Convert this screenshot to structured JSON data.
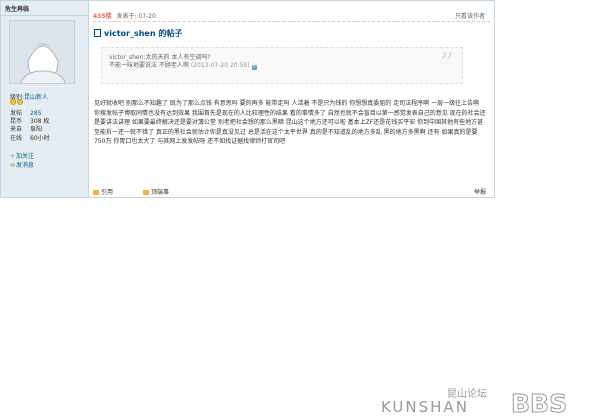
{
  "author": {
    "name": "危生再临"
  },
  "profile": {
    "level_label": "级别:",
    "level_value": "昆山新人",
    "stats": [
      {
        "key": "发帖",
        "value": "285"
      },
      {
        "key": "昆币",
        "value": "308 枚"
      },
      {
        "key": "注册时间",
        "value": ""
      }
    ],
    "extra": [
      {
        "key": "来自",
        "value": "阜阳"
      },
      {
        "key": "在线",
        "value": "60小时"
      }
    ],
    "add_follow": "加关注",
    "send_msg": "发消息"
  },
  "post": {
    "floor": "435楼",
    "posted": "发表于: 07-20",
    "only_author": "只看该作者",
    "title": "victor_shen 的帖子",
    "quote_line1": "victor_shen:太热天的  本人有空调吗?",
    "quote_line2a": "不能一味地要说法  不顾老人啊",
    "quote_time": "(2013-07-20 20:59)",
    "body": "见好就收吧 别那么不知趣了    既为了那么点钱  有意思吗  要的再多  能带走吗   人活着  不是只为钱的  你想想真委屈的  走司法程序啊      一层一级往上告啊     你搜发帖子博取同情也没有达到效果   我围首先是现在的人比较理性的结果    看的事情多了  自然也就不会盲目以第一感觉发表自己的意见    现在的社会还是要讲法讲理    如果要最终解决还是要对簿公堂   别老把社会想的那么黑暗   昆山这个地方还可以啦   基本上ZF还是花钱买平安    你到中国其他有些地方甚至能拆一还一就不错了  真正的黑社会就估计你是真没见过     总是活在这个太平世界    真的是不知道乱的地方多乱   黑的地方多黑啊   还有  如果真的是要750万  你胃口也太大了    与其网上发发帖呀  还不如找证据找律师打官司吧",
    "quote_action": "引用",
    "like_action": "顶端事",
    "report_action": "举报"
  },
  "watermark": {
    "cn": "昆山论坛",
    "en": "KUNSHAN",
    "bbs": "BBS"
  }
}
